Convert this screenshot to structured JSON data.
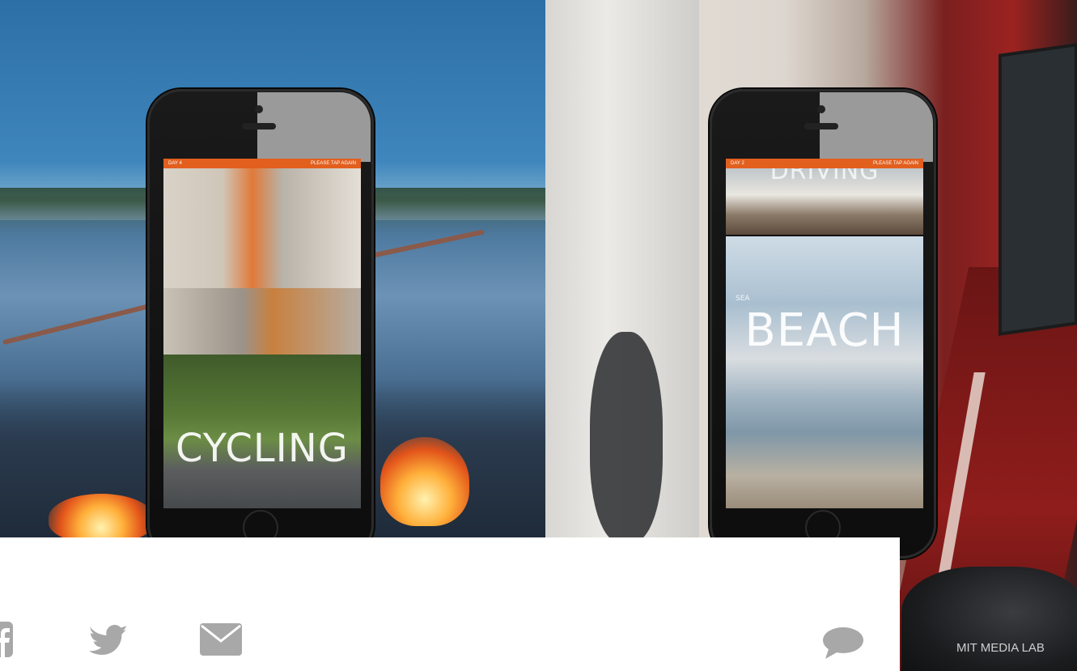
{
  "phone_left": {
    "status_left": "DAY 4",
    "status_right": "PLEASE TAP AGAIN",
    "bottom_label": "CYCLING"
  },
  "phone_right": {
    "status_left": "DAY 2",
    "status_right": "PLEASE TAP AGAIN",
    "top_label": "DRIVING",
    "small_label": "SEA",
    "bottom_label": "BEACH"
  },
  "share": {
    "facebook_icon": "facebook-icon",
    "twitter_icon": "twitter-icon",
    "email_icon": "envelope-icon",
    "comment_icon": "comment-icon"
  },
  "credit": "MIT MEDIA LAB"
}
